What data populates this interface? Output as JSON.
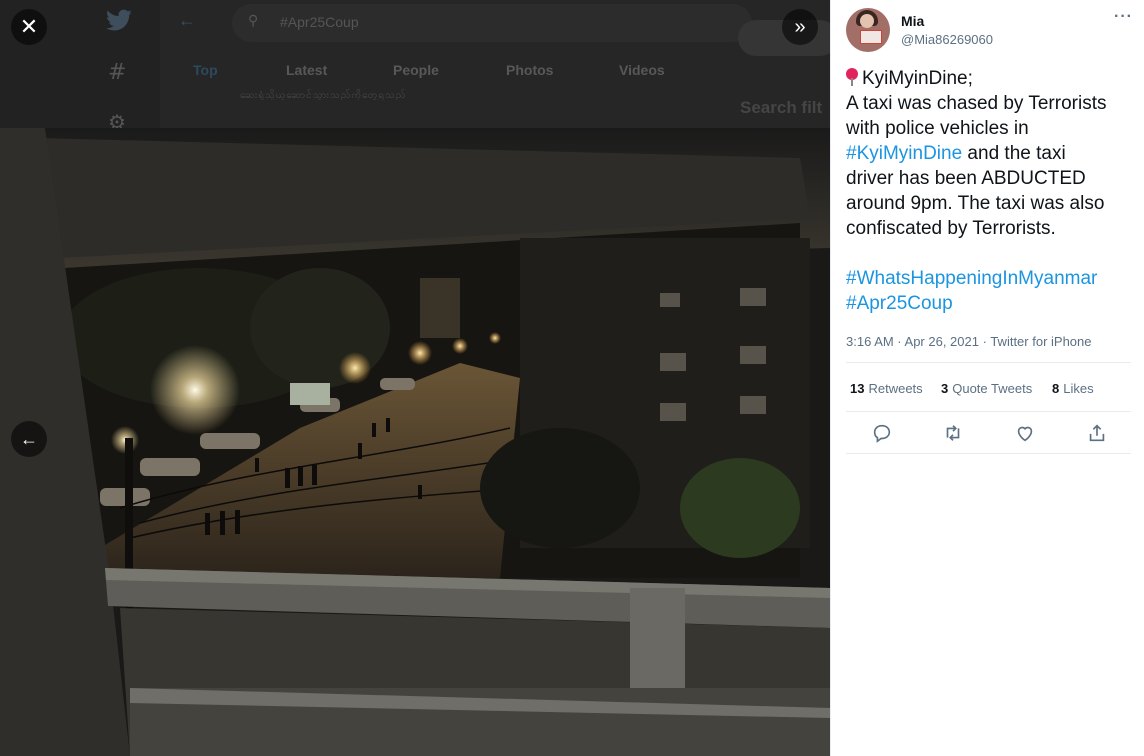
{
  "background": {
    "search_text": "#Apr25Coup",
    "tabs": [
      "Top",
      "Latest",
      "People",
      "Photos",
      "Videos"
    ],
    "myanmar_text": "ဆေးရုံသို့ယူဆောင်သွားသည်ကိုတွေ့ရသည်",
    "search_filters": "Search filt"
  },
  "icons": {
    "close": "close-icon",
    "expand": "double-chevron-right-icon",
    "prev": "arrow-left-icon",
    "reply": "reply-icon",
    "retweet": "retweet-icon",
    "like": "heart-icon",
    "share": "share-icon"
  },
  "tweet": {
    "name": "Mia",
    "handle": "@Mia86269060",
    "more": "···",
    "location": "KyiMyinDine;",
    "body": [
      "A taxi was chased by Terrorists",
      "with police vehicles in"
    ],
    "hashtag_inline": "#KyiMyinDine",
    "body_after_hashtag": " and the taxi",
    "body_rest": [
      "driver has been ABDUCTED",
      "around 9pm. The taxi was also",
      "confiscated by Terrorists."
    ],
    "hashtags": [
      "#WhatsHappeningInMyanmar",
      "#Apr25Coup"
    ],
    "time": "3:16 AM · Apr 26, 2021",
    "source": "Twitter for iPhone"
  },
  "stats": {
    "retweets_count": "13",
    "retweets_label": "Retweets",
    "quotes_count": "3",
    "quotes_label": "Quote Tweets",
    "likes_count": "8",
    "likes_label": "Likes"
  },
  "colors": {
    "link": "#1b95e0",
    "text": "#0f1419",
    "muted": "#5b7083",
    "pin": "#e0245e"
  }
}
